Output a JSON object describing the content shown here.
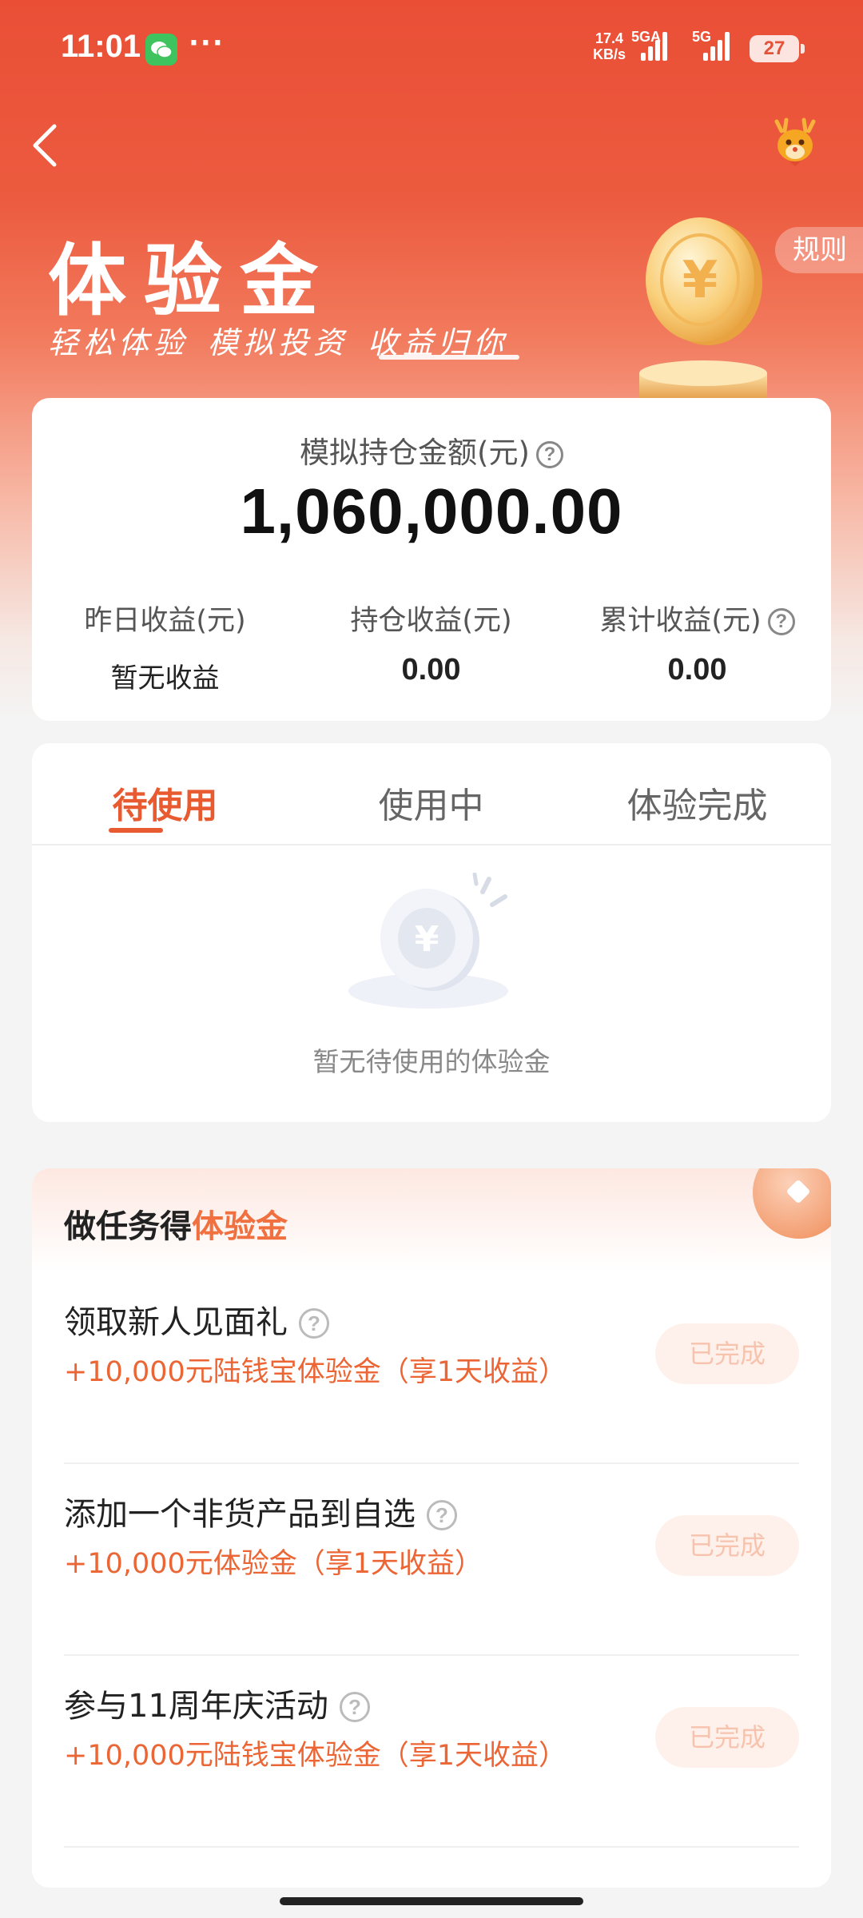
{
  "status_bar": {
    "time": "11:01",
    "net_speed_value": "17.4",
    "net_speed_unit": "KB/s",
    "sim1_label": "5GA",
    "sim2_label": "5G",
    "battery": "27",
    "more_label": "···"
  },
  "header": {
    "title": "体验金",
    "subtitle_parts": [
      "轻松体验",
      "模拟投资",
      "收益归你"
    ],
    "rules_label": "规则",
    "coin_symbol": "¥"
  },
  "summary": {
    "holding_label": "模拟持仓金额(元)",
    "holding_value": "1,060,000.00",
    "metrics": [
      {
        "label": "昨日收益(元)",
        "value": "暂无收益"
      },
      {
        "label": "持仓收益(元)",
        "value": "0.00"
      },
      {
        "label": "累计收益(元)",
        "value": "0.00"
      }
    ]
  },
  "tabs": {
    "items": [
      "待使用",
      "使用中",
      "体验完成"
    ],
    "active_index": 0,
    "empty_text": "暂无待使用的体验金",
    "empty_coin_symbol": "¥"
  },
  "tasks": {
    "title_prefix": "做任务得",
    "title_accent": "体验金",
    "items": [
      {
        "name": "领取新人见面礼",
        "reward": "+10,000元陆钱宝体验金（享1天收益）",
        "status": "已完成"
      },
      {
        "name": "添加一个非货产品到自选",
        "reward": "+10,000元体验金（享1天收益）",
        "status": "已完成"
      },
      {
        "name": "参与11周年庆活动",
        "reward": "+10,000元陆钱宝体验金（享1天收益）",
        "status": "已完成"
      }
    ]
  },
  "colors": {
    "brand": "#EA4F36",
    "accent": "#E85A30",
    "reward_text": "#EC6534",
    "done_button_bg": "#FEF1EC",
    "done_button_text": "#F7C3AD"
  },
  "icons": {
    "back": "back-arrow-icon",
    "mascot": "deer-mascot-icon",
    "help": "question-mark-icon",
    "status_app": "wechat-icon",
    "hero_coin": "yuan-coin-icon",
    "empty_state": "empty-coin-icon",
    "tasks_deco": "gift-icon"
  }
}
